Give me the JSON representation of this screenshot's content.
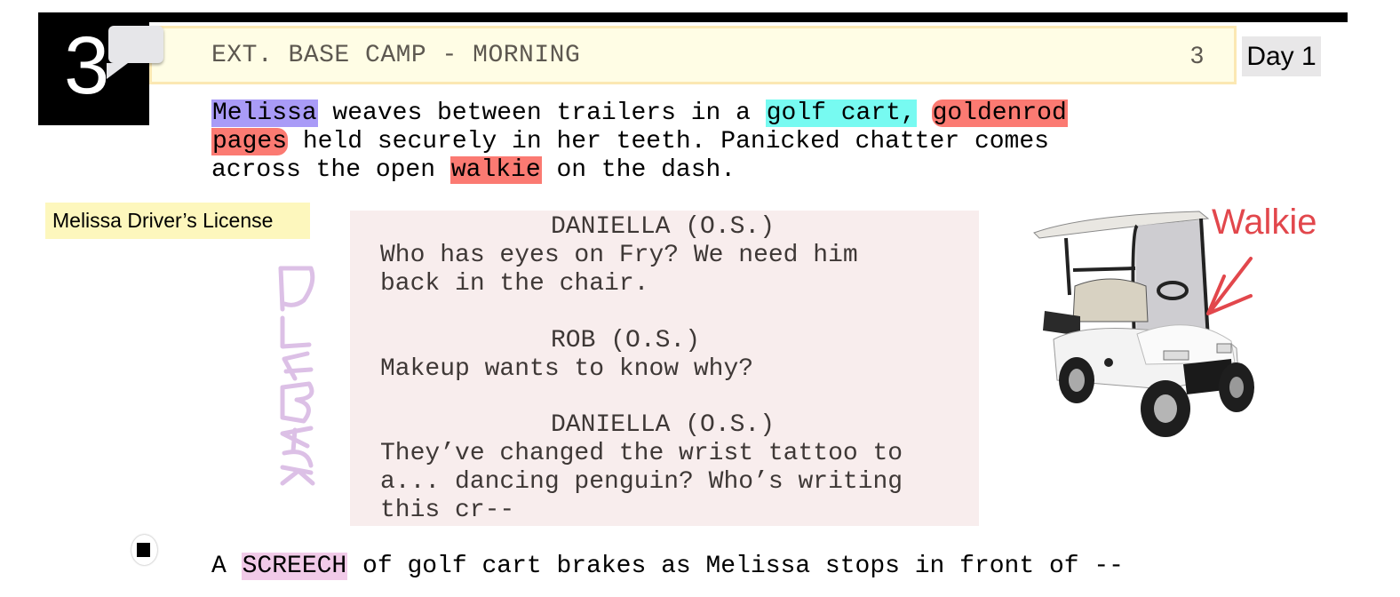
{
  "scene": {
    "number": "3",
    "number_right": "3",
    "heading": "EXT. BASE CAMP - MORNING",
    "day": "Day 1"
  },
  "action1": {
    "line1": [
      {
        "text": "Melissa",
        "tag": "cast"
      },
      {
        "text": " weaves between trailers in a ",
        "tag": ""
      },
      {
        "text": "golf cart,",
        "tag": "vehicle"
      },
      {
        "text": " ",
        "tag": ""
      },
      {
        "text": "goldenrod",
        "tag": "prop"
      }
    ],
    "line2": [
      {
        "text": "pages",
        "tag": "prop"
      },
      {
        "text": " held securely in her teeth. Panicked chatter comes",
        "tag": ""
      }
    ],
    "line3": [
      {
        "text": "across the open ",
        "tag": ""
      },
      {
        "text": "walkie",
        "tag": "prop"
      },
      {
        "text": " on the dash.",
        "tag": ""
      }
    ]
  },
  "notes": {
    "license": "Melissa Driver’s License",
    "playback": "PLAYBACK",
    "walkie": "Walkie"
  },
  "dialogue": [
    {
      "character": "DANIELLA (O.S.)",
      "lines": [
        "Who has eyes on Fry? We need him",
        "back in the chair."
      ]
    },
    {
      "character": "ROB (O.S.)",
      "lines": [
        "Makeup wants to know why?"
      ]
    },
    {
      "character": "DANIELLA (O.S.)",
      "lines": [
        "They’ve changed the wrist tattoo to",
        "a... dancing penguin? Who’s writing",
        "this cr--"
      ]
    }
  ],
  "action2": [
    {
      "text": "A ",
      "tag": ""
    },
    {
      "text": "SCREECH",
      "tag": "sound"
    },
    {
      "text": " of golf cart brakes as Melissa stops in front of --",
      "tag": ""
    }
  ],
  "colors": {
    "cast": "#a99bf7",
    "vehicle": "#77faf1",
    "prop": "#fb7a72",
    "sound": "#f1cae8",
    "note_yellow": "#fdf7bd",
    "dialog_bg": "#f8eded",
    "walkie_red": "#e2474c",
    "playback_lilac": "#dcc0e6"
  },
  "image": {
    "alt": "golf-cart photo"
  }
}
